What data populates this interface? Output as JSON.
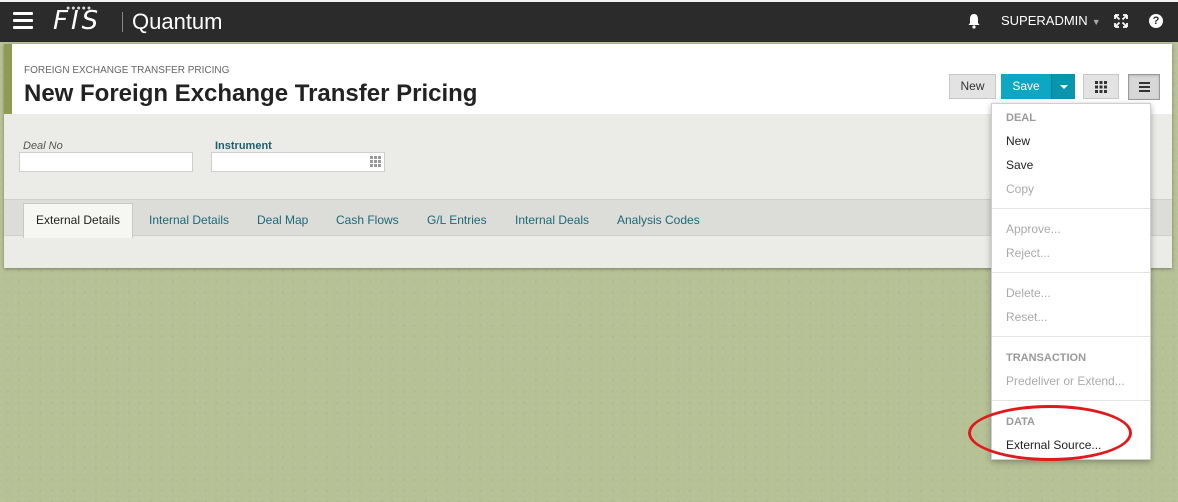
{
  "topbar": {
    "logo": "FIS",
    "product": "Quantum",
    "user": "SUPERADMIN",
    "help_glyph": "?",
    "icons": [
      "hamburger-icon",
      "bell-icon",
      "chevron-down-icon",
      "expand-icon",
      "help-icon"
    ]
  },
  "header": {
    "breadcrumb": "FOREIGN EXCHANGE TRANSFER PRICING",
    "title": "New Foreign Exchange Transfer Pricing"
  },
  "toolbar": {
    "new_label": "New",
    "save_label": "Save"
  },
  "fields": {
    "deal_no_label": "Deal No",
    "deal_no_value": "",
    "instrument_label": "Instrument",
    "instrument_value": ""
  },
  "tabs": [
    {
      "label": "External Details",
      "active": true
    },
    {
      "label": "Internal Details",
      "active": false
    },
    {
      "label": "Deal Map",
      "active": false
    },
    {
      "label": "Cash Flows",
      "active": false
    },
    {
      "label": "G/L Entries",
      "active": false
    },
    {
      "label": "Internal Deals",
      "active": false
    },
    {
      "label": "Analysis Codes",
      "active": false
    }
  ],
  "menu": {
    "deal_header": "DEAL",
    "new": "New",
    "save": "Save",
    "copy": "Copy",
    "approve": "Approve...",
    "reject": "Reject...",
    "delete": "Delete...",
    "reset": "Reset...",
    "transaction_header": "TRANSACTION",
    "predeliver": "Predeliver or Extend...",
    "data_header": "DATA",
    "external_source": "External Source..."
  },
  "colors": {
    "topbar": "#2b2b2b",
    "accent": "#0ea7c3",
    "background": "#b7c196",
    "panel_accent": "#8f9a54",
    "tab_text": "#1b6a78",
    "highlight": "#e0191c"
  }
}
